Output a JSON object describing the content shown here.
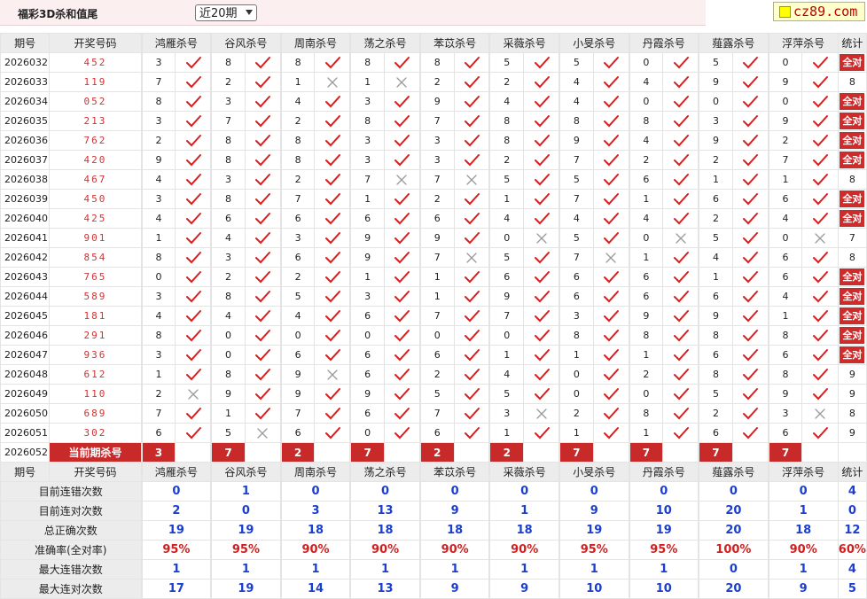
{
  "header": {
    "title": "福彩3D杀和值尾",
    "period_select": "近20期",
    "logo": "cz89.com"
  },
  "columns": {
    "period": "期号",
    "numbers": "开奖号码",
    "experts": [
      "鸿雁杀号",
      "谷风杀号",
      "周南杀号",
      "荡之杀号",
      "苯苡杀号",
      "采薇杀号",
      "小旻杀号",
      "丹霞杀号",
      "薤露杀号",
      "浮萍杀号"
    ],
    "stat": "统计"
  },
  "rows": [
    {
      "period": "2026032",
      "numbers": "452",
      "vals": [
        3,
        8,
        8,
        8,
        8,
        5,
        5,
        0,
        5,
        0
      ],
      "marks": [
        1,
        1,
        1,
        1,
        1,
        1,
        1,
        1,
        1,
        1
      ],
      "stat": "全对"
    },
    {
      "period": "2026033",
      "numbers": "119",
      "vals": [
        7,
        2,
        1,
        1,
        2,
        2,
        4,
        4,
        9,
        9
      ],
      "marks": [
        1,
        1,
        0,
        0,
        1,
        1,
        1,
        1,
        1,
        1
      ],
      "stat": "8"
    },
    {
      "period": "2026034",
      "numbers": "052",
      "vals": [
        8,
        3,
        4,
        3,
        9,
        4,
        4,
        0,
        0,
        0
      ],
      "marks": [
        1,
        1,
        1,
        1,
        1,
        1,
        1,
        1,
        1,
        1
      ],
      "stat": "全对"
    },
    {
      "period": "2026035",
      "numbers": "213",
      "vals": [
        3,
        7,
        2,
        8,
        7,
        8,
        8,
        8,
        3,
        9
      ],
      "marks": [
        1,
        1,
        1,
        1,
        1,
        1,
        1,
        1,
        1,
        1
      ],
      "stat": "全对"
    },
    {
      "period": "2026036",
      "numbers": "762",
      "vals": [
        2,
        8,
        8,
        3,
        3,
        8,
        9,
        4,
        9,
        2
      ],
      "marks": [
        1,
        1,
        1,
        1,
        1,
        1,
        1,
        1,
        1,
        1
      ],
      "stat": "全对"
    },
    {
      "period": "2026037",
      "numbers": "420",
      "vals": [
        9,
        8,
        8,
        3,
        3,
        2,
        7,
        2,
        2,
        7
      ],
      "marks": [
        1,
        1,
        1,
        1,
        1,
        1,
        1,
        1,
        1,
        1
      ],
      "stat": "全对"
    },
    {
      "period": "2026038",
      "numbers": "467",
      "vals": [
        4,
        3,
        2,
        7,
        7,
        5,
        5,
        6,
        1,
        1
      ],
      "marks": [
        1,
        1,
        1,
        0,
        0,
        1,
        1,
        1,
        1,
        1
      ],
      "stat": "8"
    },
    {
      "period": "2026039",
      "numbers": "450",
      "vals": [
        3,
        8,
        7,
        1,
        2,
        1,
        7,
        1,
        6,
        6
      ],
      "marks": [
        1,
        1,
        1,
        1,
        1,
        1,
        1,
        1,
        1,
        1
      ],
      "stat": "全对"
    },
    {
      "period": "2026040",
      "numbers": "425",
      "vals": [
        4,
        6,
        6,
        6,
        6,
        4,
        4,
        4,
        2,
        4
      ],
      "marks": [
        1,
        1,
        1,
        1,
        1,
        1,
        1,
        1,
        1,
        1
      ],
      "stat": "全对"
    },
    {
      "period": "2026041",
      "numbers": "901",
      "vals": [
        1,
        4,
        3,
        9,
        9,
        0,
        5,
        0,
        5,
        0
      ],
      "marks": [
        1,
        1,
        1,
        1,
        1,
        0,
        1,
        0,
        1,
        0
      ],
      "stat": "7"
    },
    {
      "period": "2026042",
      "numbers": "854",
      "vals": [
        8,
        3,
        6,
        9,
        7,
        5,
        7,
        1,
        4,
        6
      ],
      "marks": [
        1,
        1,
        1,
        1,
        0,
        1,
        0,
        1,
        1,
        1
      ],
      "stat": "8"
    },
    {
      "period": "2026043",
      "numbers": "765",
      "vals": [
        0,
        2,
        2,
        1,
        1,
        6,
        6,
        6,
        1,
        6
      ],
      "marks": [
        1,
        1,
        1,
        1,
        1,
        1,
        1,
        1,
        1,
        1
      ],
      "stat": "全对"
    },
    {
      "period": "2026044",
      "numbers": "589",
      "vals": [
        3,
        8,
        5,
        3,
        1,
        9,
        6,
        6,
        6,
        4
      ],
      "marks": [
        1,
        1,
        1,
        1,
        1,
        1,
        1,
        1,
        1,
        1
      ],
      "stat": "全对"
    },
    {
      "period": "2026045",
      "numbers": "181",
      "vals": [
        4,
        4,
        4,
        6,
        7,
        7,
        3,
        9,
        9,
        1
      ],
      "marks": [
        1,
        1,
        1,
        1,
        1,
        1,
        1,
        1,
        1,
        1
      ],
      "stat": "全对"
    },
    {
      "period": "2026046",
      "numbers": "291",
      "vals": [
        8,
        0,
        0,
        0,
        0,
        0,
        8,
        8,
        8,
        8
      ],
      "marks": [
        1,
        1,
        1,
        1,
        1,
        1,
        1,
        1,
        1,
        1
      ],
      "stat": "全对"
    },
    {
      "period": "2026047",
      "numbers": "936",
      "vals": [
        3,
        0,
        6,
        6,
        6,
        1,
        1,
        1,
        6,
        6
      ],
      "marks": [
        1,
        1,
        1,
        1,
        1,
        1,
        1,
        1,
        1,
        1
      ],
      "stat": "全对"
    },
    {
      "period": "2026048",
      "numbers": "612",
      "vals": [
        1,
        8,
        9,
        6,
        2,
        4,
        0,
        2,
        8,
        8
      ],
      "marks": [
        1,
        1,
        0,
        1,
        1,
        1,
        1,
        1,
        1,
        1
      ],
      "stat": "9"
    },
    {
      "period": "2026049",
      "numbers": "110",
      "vals": [
        2,
        9,
        9,
        9,
        5,
        5,
        0,
        0,
        5,
        9
      ],
      "marks": [
        0,
        1,
        1,
        1,
        1,
        1,
        1,
        1,
        1,
        1
      ],
      "stat": "9"
    },
    {
      "period": "2026050",
      "numbers": "689",
      "vals": [
        7,
        1,
        7,
        6,
        7,
        3,
        2,
        8,
        2,
        3
      ],
      "marks": [
        1,
        1,
        1,
        1,
        1,
        0,
        1,
        1,
        1,
        0
      ],
      "stat": "8"
    },
    {
      "period": "2026051",
      "numbers": "302",
      "vals": [
        6,
        5,
        6,
        0,
        6,
        1,
        1,
        1,
        6,
        6
      ],
      "marks": [
        1,
        0,
        1,
        1,
        1,
        1,
        1,
        1,
        1,
        1
      ],
      "stat": "9"
    }
  ],
  "current": {
    "period": "2026052",
    "label": "当前期杀号",
    "kills": [
      3,
      7,
      2,
      7,
      2,
      2,
      7,
      7,
      7,
      7
    ]
  },
  "summary": [
    {
      "label": "目前连错次数",
      "values": [
        "0",
        "1",
        "0",
        "0",
        "0",
        "0",
        "0",
        "0",
        "0",
        "0"
      ],
      "stat": "4"
    },
    {
      "label": "目前连对次数",
      "values": [
        "2",
        "0",
        "3",
        "13",
        "9",
        "1",
        "9",
        "10",
        "20",
        "1"
      ],
      "stat": "0"
    },
    {
      "label": "总正确次数",
      "values": [
        "19",
        "19",
        "18",
        "18",
        "18",
        "18",
        "19",
        "19",
        "20",
        "18"
      ],
      "stat": "12"
    },
    {
      "label": "准确率(全对率)",
      "values": [
        "95%",
        "95%",
        "90%",
        "90%",
        "90%",
        "90%",
        "95%",
        "95%",
        "100%",
        "90%"
      ],
      "stat": "60%",
      "rate": true
    },
    {
      "label": "最大连错次数",
      "values": [
        "1",
        "1",
        "1",
        "1",
        "1",
        "1",
        "1",
        "1",
        "0",
        "1"
      ],
      "stat": "4"
    },
    {
      "label": "最大连对次数",
      "values": [
        "17",
        "19",
        "14",
        "13",
        "9",
        "9",
        "10",
        "10",
        "20",
        "9"
      ],
      "stat": "5"
    }
  ],
  "colors": {
    "check": "#d81e1e",
    "cross": "#9a9a9a",
    "badge": "#cf2b2b",
    "summary_value": "#1a3fcf",
    "rate": "#d12020"
  },
  "icons": {
    "correct": "check-icon",
    "wrong": "cross-icon",
    "select_arrow": "chevron-down-icon"
  }
}
